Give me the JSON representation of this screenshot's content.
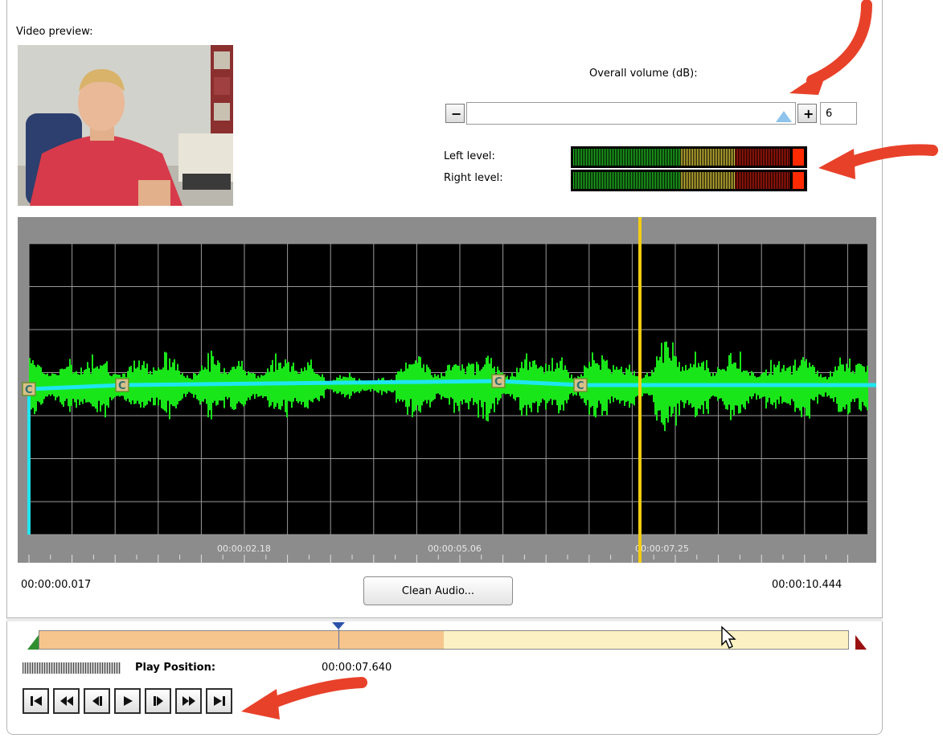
{
  "video": {
    "label": "Video preview:"
  },
  "volume": {
    "label": "Overall volume (dB):",
    "minus_label": "−",
    "plus_label": "+",
    "value": "6",
    "slider_fraction": 0.97
  },
  "levels": {
    "left_label": "Left level:",
    "right_label": "Right level:",
    "colors": {
      "green": "#22c422",
      "yellow": "#e6d23c",
      "red": "#c21a0c",
      "peak": "#ff2a00"
    }
  },
  "waveform": {
    "background": "#000000",
    "grid_color": "#9a9a9a",
    "wave_color": "#19e619",
    "envelope_color": "#1ee6f0",
    "playhead_color": "#f5cc10",
    "time_labels": [
      "00:00:02.18",
      "00:00:05.06",
      "00:00:07.25"
    ],
    "start_time": "00:00:00.017",
    "end_time": "00:00:10.444",
    "envelope_point_label": "C"
  },
  "actions": {
    "clean_audio": "Clean Audio..."
  },
  "playback": {
    "label": "Play Position:",
    "position": "00:00:07.640",
    "progress_fraction": 0.5,
    "marker_fraction": 0.37
  },
  "transport": [
    {
      "name": "go-to-start-button",
      "icon": "skip-start-icon"
    },
    {
      "name": "rewind-button",
      "icon": "rewind-icon"
    },
    {
      "name": "step-back-button",
      "icon": "step-back-icon"
    },
    {
      "name": "play-button",
      "icon": "play-icon"
    },
    {
      "name": "step-forward-button",
      "icon": "step-forward-icon"
    },
    {
      "name": "fast-forward-button",
      "icon": "fast-forward-icon"
    },
    {
      "name": "go-to-end-button",
      "icon": "skip-end-icon"
    }
  ],
  "annotation_color": "#e8412a"
}
